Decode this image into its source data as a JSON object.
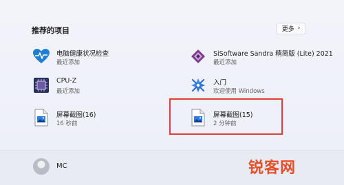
{
  "section": {
    "title": "推荐的项目",
    "more_label": "更多"
  },
  "items": [
    {
      "name": "电脑健康状况检查",
      "sub": "最近添加",
      "icon": "health-heart-icon"
    },
    {
      "name": "SiSoftware Sandra 精简版 (Lite) 2021",
      "sub": "最近添加",
      "icon": "sandra-icon"
    },
    {
      "name": "CPU-Z",
      "sub": "最近添加",
      "icon": "cpuz-icon"
    },
    {
      "name": "入门",
      "sub": "欢迎使用 Windows",
      "icon": "get-started-icon"
    },
    {
      "name": "屏幕截图(16)",
      "sub": "16 秒前",
      "icon": "image-file-icon"
    },
    {
      "name": "屏幕截图(15)",
      "sub": "2 分钟前",
      "icon": "image-file-icon"
    }
  ],
  "user": {
    "name": "MC"
  },
  "watermark": "锐客网",
  "colors": {
    "accent_heart": "#1f7fd1",
    "highlight": "#e23c3c",
    "watermark": "#e4502a"
  }
}
